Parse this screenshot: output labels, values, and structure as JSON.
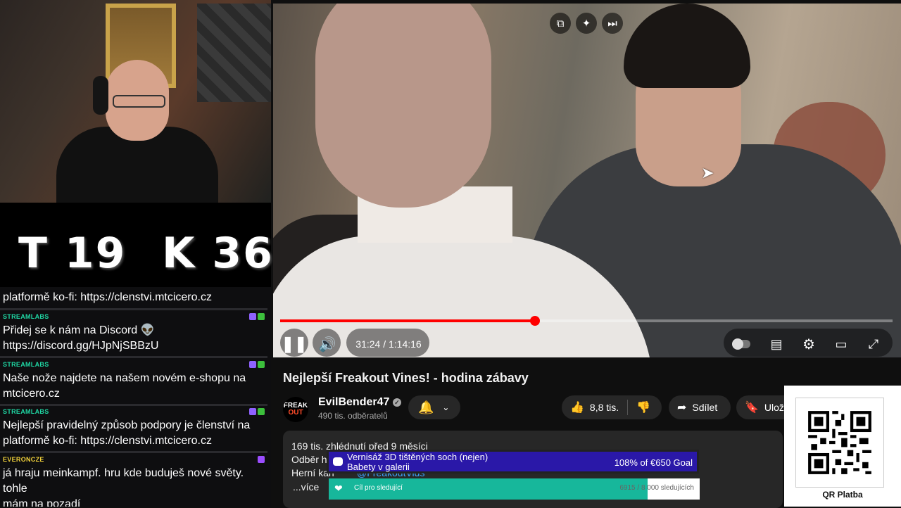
{
  "counters": {
    "t": "T 19",
    "k": "K 36"
  },
  "chat": {
    "fragment": "platformě ko-fi: https://clenstvi.mtcicero.cz",
    "messages": [
      {
        "user": "STREAMLABS",
        "lines": [
          "Přidej se k nám na Discord 👽",
          "https://discord.gg/HJpNjSBBzU"
        ]
      },
      {
        "user": "STREAMLABS",
        "lines": [
          "Naše nože najdete na našem novém e-shopu na",
          "mtcicero.cz"
        ]
      },
      {
        "user": "STREAMLABS",
        "lines": [
          "Nejlepší pravidelný způsob podpory je členství na",
          "platformě ko-fi: https://clenstvi.mtcicero.cz"
        ]
      },
      {
        "user": "EVERONCZE",
        "lines": [
          "já hraju meinkampf. hru kde buduješ nové světy. tohle",
          "mám na pozadí"
        ]
      }
    ]
  },
  "video": {
    "time": "31:24 / 1:14:16",
    "progress_percent": 41.6,
    "top_icons": [
      "miniplayer-icon",
      "sparkle-icon",
      "skip-icon"
    ]
  },
  "title": "Nejlepší Freakout Vines! - hodina zábavy",
  "channel": {
    "avatar_line1": "FREAK",
    "avatar_line2": "OUT",
    "name": "EvilBender47",
    "subscribers": "490 tis. odběratelů"
  },
  "actions": {
    "likes": "8,8 tis.",
    "share": "Sdílet",
    "save": "Uloži"
  },
  "description": {
    "stats": "169 tis. zhlédnutí  před 9 měsíci",
    "line2": "Odběr h",
    "line3": "Herní kan",
    "line3_rest": "@FreakoutVids",
    "more": "...více"
  },
  "goals": {
    "donation_title_1": "Vernisáž 3D tištěných soch (nejen)",
    "donation_title_2": "Babety v galerii",
    "donation_amount": "108% of €650 Goal",
    "follower_label": "Cíl pro sledující",
    "follower_count": "6915 / 8 000 sledujících",
    "follower_progress_percent": 86
  },
  "qr": {
    "label": "QR Platba"
  },
  "colors": {
    "accent": "#ff0000",
    "streamlabs": "#1fd6a3",
    "goal_blue": "#2a18a8",
    "goal_teal": "#17b79b"
  }
}
